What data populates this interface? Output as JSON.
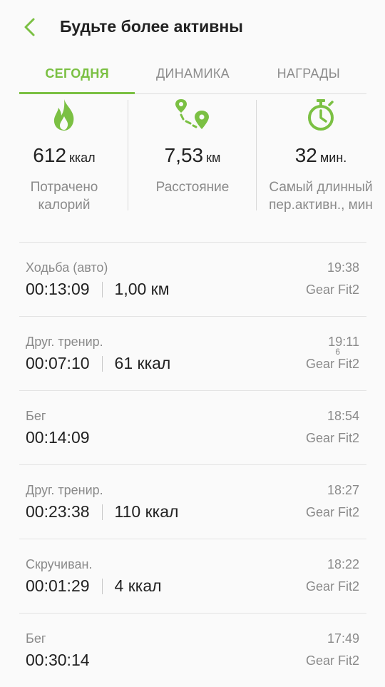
{
  "header": {
    "title": "Будьте более активны",
    "back_icon": "chevron-left-icon",
    "accent_color": "#7bc043"
  },
  "tabs": [
    {
      "label": "СЕГОДНЯ",
      "active": true
    },
    {
      "label": "ДИНАМИКА",
      "active": false
    },
    {
      "label": "НАГРАДЫ",
      "active": false
    }
  ],
  "stats": [
    {
      "icon": "flame-icon",
      "value": "612",
      "unit": "ккал",
      "label_line1": "Потрачено",
      "label_line2": "калорий"
    },
    {
      "icon": "route-icon",
      "value": "7,53",
      "unit": "км",
      "label_line1": "Расстояние",
      "label_line2": ""
    },
    {
      "icon": "stopwatch-icon",
      "value": "32",
      "unit": "мин.",
      "label_line1": "Самый длинный",
      "label_line2": "пер.активн., мин"
    }
  ],
  "activities": [
    {
      "activity": "Ходьба (авто)",
      "duration": "00:13:09",
      "metric": "1,00 км",
      "time": "19:38",
      "device": "Gear Fit2",
      "mark": ""
    },
    {
      "activity": "Друг. тренир.",
      "duration": "00:07:10",
      "metric": "61 ккал",
      "time": "19:11",
      "device": "Gear Fit2",
      "mark": "6"
    },
    {
      "activity": "Бег",
      "duration": "00:14:09",
      "metric": "",
      "time": "18:54",
      "device": "Gear Fit2",
      "mark": ""
    },
    {
      "activity": "Друг. тренир.",
      "duration": "00:23:38",
      "metric": "110 ккал",
      "time": "18:27",
      "device": "Gear Fit2",
      "mark": ""
    },
    {
      "activity": "Скручиван.",
      "duration": "00:01:29",
      "metric": "4 ккал",
      "time": "18:22",
      "device": "Gear Fit2",
      "mark": ""
    },
    {
      "activity": "Бег",
      "duration": "00:30:14",
      "metric": "",
      "time": "17:49",
      "device": "Gear Fit2",
      "mark": ""
    }
  ]
}
